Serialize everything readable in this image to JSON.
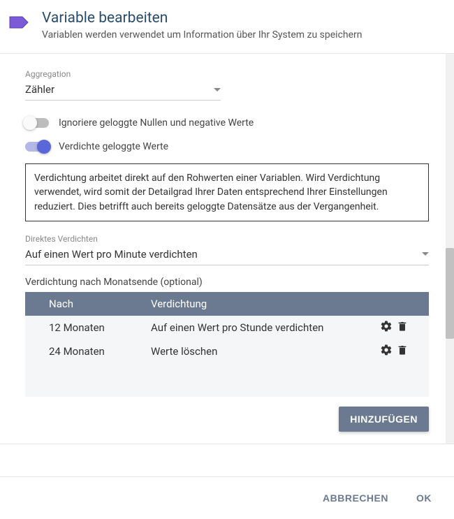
{
  "header": {
    "title": "Variable bearbeiten",
    "subtitle": "Variablen werden verwendet um Information über Ihr System zu speichern"
  },
  "aggregation": {
    "label": "Aggregation",
    "value": "Zähler"
  },
  "toggles": {
    "ignore_zeros": {
      "label": "Ignoriere geloggte Nullen und negative Werte"
    },
    "compact": {
      "label": "Verdichte geloggte Werte"
    }
  },
  "info_text": "Verdichtung arbeitet direkt auf den Rohwerten einer Variablen. Wird Verdichtung verwendet, wird somit der Detailgrad Ihrer Daten entsprechend Ihrer Einstellungen reduziert. Dies betrifft auch bereits geloggte Datensätze aus der Vergangenheit.",
  "direct": {
    "label": "Direktes Verdichten",
    "value": "Auf einen Wert pro Minute verdichten"
  },
  "month_end": {
    "label": "Verdichtung nach Monatsende (optional)",
    "col_after": "Nach",
    "col_verd": "Verdichtung",
    "rows": [
      {
        "after": "12 Monaten",
        "action": "Auf einen Wert pro Stunde verdichten"
      },
      {
        "after": "24 Monaten",
        "action": "Werte löschen"
      }
    ],
    "add_label": "HINZUFÜGEN"
  },
  "footer": {
    "cancel": "ABBRECHEN",
    "ok": "OK"
  }
}
